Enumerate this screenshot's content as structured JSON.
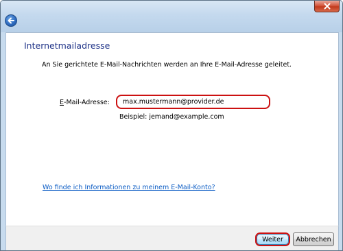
{
  "window": {
    "title": "Internetmailadresse"
  },
  "main": {
    "description": "An Sie gerichtete E-Mail-Nachrichten werden an Ihre E-Mail-Adresse geleitet.",
    "email_label_accesskey": "E",
    "email_label_rest": "-Mail-Adresse:",
    "email_value": "max.mustermann@provider.de",
    "example": "Beispiel: jemand@example.com",
    "help_link": "Wo finde ich Informationen zu meinem E-Mail-Konto?"
  },
  "footer": {
    "next_label": "Weiter",
    "cancel_label": "Abbrechen"
  },
  "colors": {
    "title_text": "#1e3287",
    "link_text": "#0b5cc4",
    "highlight_red": "#cc1111",
    "chrome_blue": "#c7dbee"
  },
  "icons": {
    "back": "back-arrow-icon",
    "close": "close-icon"
  }
}
